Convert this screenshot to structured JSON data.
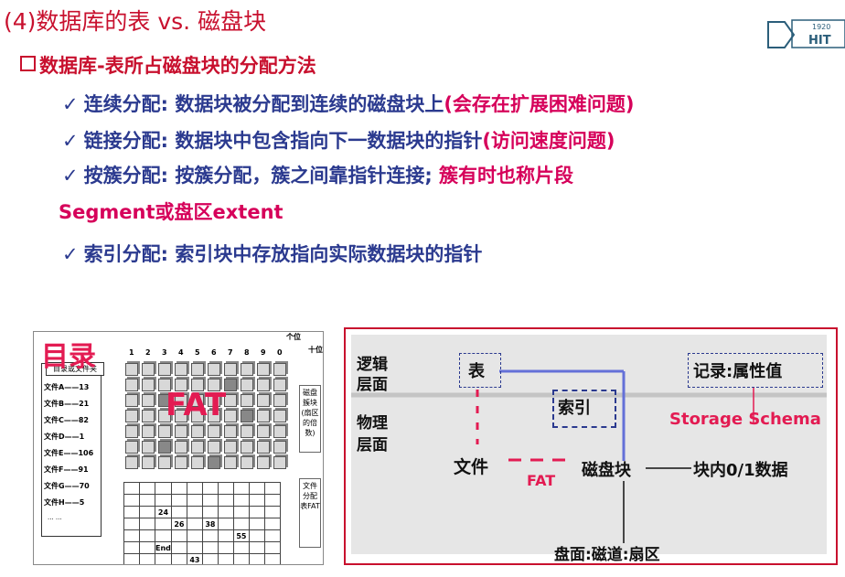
{
  "title": "(4)数据库的表 vs. 磁盘块",
  "logo": {
    "year": "1920",
    "text": "HIT"
  },
  "subtitle": "数据库-表所占磁盘块的分配方法",
  "bullets": [
    {
      "check": "✓",
      "main": "连续分配: 数据块被分配到连续的磁盘块上",
      "note": "(会存在扩展困难问题)"
    },
    {
      "check": "✓",
      "main": "链接分配: 数据块中包含指向下一数据块的指针",
      "note": "(访问速度问题)"
    },
    {
      "check": "✓",
      "main": "按簇分配: 按簇分配，簇之间靠指针连接; ",
      "note": "簇有时也称片段"
    },
    {
      "check": "✓",
      "main": "索引分配: 索引块中存放指向实际数据块的指针",
      "note": ""
    }
  ],
  "bullet3_cont": "Segment或盘区extent",
  "left_figure": {
    "mulu": "目录",
    "fat": "FAT",
    "dir_header": "目录或文件夹",
    "dir_rows": [
      "文件A——13",
      "文件B——21",
      "文件C——82",
      "文件D——1",
      "文件E——106",
      "文件F——91",
      "文件G——70",
      "文件H——5"
    ],
    "dir_more": "... ...",
    "col_numbers": [
      "1",
      "2",
      "3",
      "4",
      "5",
      "6",
      "7",
      "8",
      "9",
      "0"
    ],
    "top_right": "个位",
    "top_right2": "十位",
    "right_label1": "磁盘簇块(扇区的倍数)",
    "right_label2": "文件分配表FAT",
    "table_values": [
      "24",
      "26",
      "38",
      "55",
      "End",
      "43"
    ]
  },
  "right_figure": {
    "logic_layer": [
      "逻辑",
      "层面"
    ],
    "physical_layer": [
      "物理",
      "层面"
    ],
    "table": "表",
    "record": "记录:属性值",
    "index": "索引",
    "storage_schema": "Storage Schema",
    "file": "文件",
    "fat": "FAT",
    "disk_block": "磁盘块",
    "block_data": "块内0/1数据",
    "disk_address": "盘面:磁道:扇区"
  }
}
